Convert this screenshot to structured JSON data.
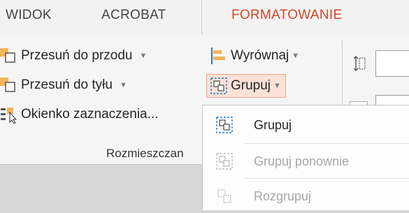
{
  "tabs": [
    "WIDOK",
    "ACROBAT",
    "FORMATOWANIE"
  ],
  "ribbon": {
    "arrange": {
      "bring_forward": "Przesuń do przodu",
      "send_backward": "Przesuń do tyłu",
      "selection_pane": "Okienko zaznaczenia...",
      "align": "Wyrównaj",
      "group": "Grupuj",
      "group_label": "Rozmieszczan"
    }
  },
  "group_menu": {
    "items": [
      "Grupuj",
      "Grupuj ponownie",
      "Rozgrupuj"
    ]
  },
  "colors": {
    "accent": "#d24726",
    "highlight": "#fbe1d8",
    "icon_blue": "#2b79c2",
    "icon_orange": "#f3b35a"
  }
}
